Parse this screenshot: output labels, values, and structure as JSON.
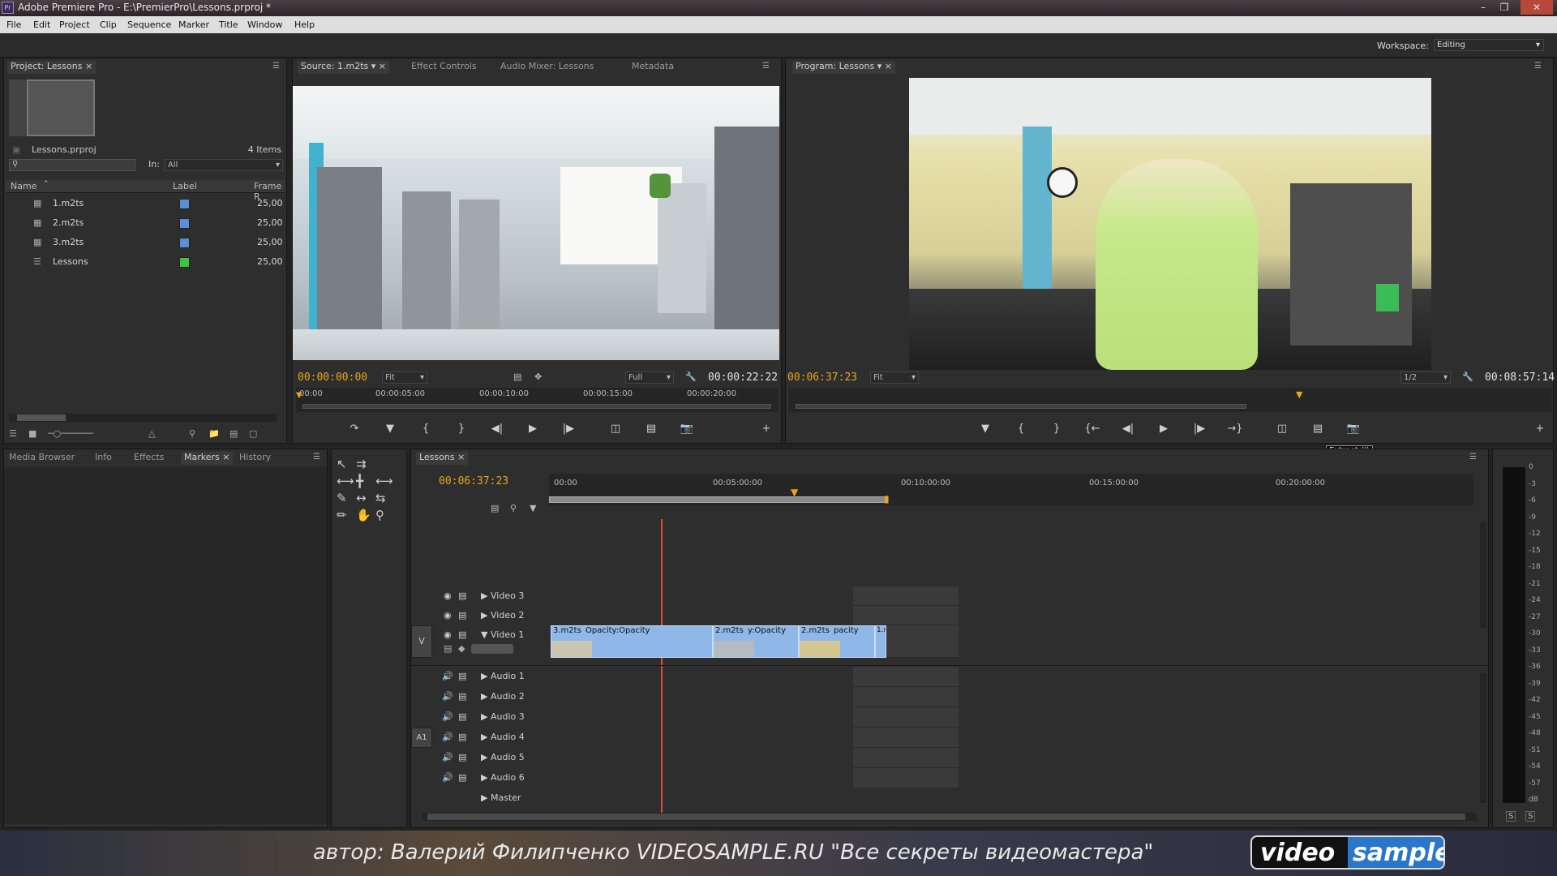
{
  "window": {
    "title": "Adobe Premiere Pro - E:\\PremierPro\\Lessons.prproj *",
    "app_icon": "Pr"
  },
  "menu": [
    "File",
    "Edit",
    "Project",
    "Clip",
    "Sequence",
    "Marker",
    "Title",
    "Window",
    "Help"
  ],
  "workspace": {
    "label": "Workspace:",
    "value": "Editing"
  },
  "project": {
    "tab": "Project: Lessons",
    "file": "Lessons.prproj",
    "count": "4 Items",
    "in_label": "In:",
    "in_value": "All",
    "columns": [
      "Name",
      "Label",
      "Frame R"
    ],
    "items": [
      {
        "name": "1.m2ts",
        "label_color": "#5a8fd8",
        "rate": "25,00"
      },
      {
        "name": "2.m2ts",
        "label_color": "#5a8fd8",
        "rate": "25,00"
      },
      {
        "name": "3.m2ts",
        "label_color": "#5a8fd8",
        "rate": "25,00"
      },
      {
        "name": "Lessons",
        "label_color": "#3cc63c",
        "rate": "25,00"
      }
    ]
  },
  "source": {
    "tabs": [
      "Source: 1.m2ts",
      "Effect Controls",
      "Audio Mixer: Lessons",
      "Metadata"
    ],
    "timecode": "00:00:00:00",
    "fit": "Fit",
    "quality": "Full",
    "duration": "00:00:22:22",
    "ruler": [
      "00:00",
      "00:00:05:00",
      "00:00:10:00",
      "00:00:15:00",
      "00:00:20:00"
    ]
  },
  "program": {
    "tab": "Program: Lessons",
    "timecode": "00:06:37:23",
    "fit": "Fit",
    "quality": "1/2",
    "duration": "00:08:57:14",
    "tooltip": "Extract (')"
  },
  "bottom_left": {
    "tabs": [
      "Media Browser",
      "Info",
      "Effects",
      "Markers",
      "History"
    ]
  },
  "timeline": {
    "tab": "Lessons",
    "timecode": "00:06:37:23",
    "ruler": [
      "00:00",
      "00:05:00:00",
      "00:10:00:00",
      "00:15:00:00",
      "00:20:00:00"
    ],
    "video_tracks": [
      "Video 3",
      "Video 2",
      "Video 1"
    ],
    "audio_tracks": [
      "Audio 1",
      "Audio 2",
      "Audio 3",
      "Audio 4",
      "Audio 5",
      "Audio 6"
    ],
    "master": "Master",
    "v_target": "V",
    "a_target": "A1",
    "clips": [
      {
        "name": "3.m2ts",
        "effect": "Opacity:Opacity"
      },
      {
        "name": "2.m2ts",
        "effect": "y:Opacity"
      },
      {
        "name": "2.m2ts",
        "effect": "pacity"
      },
      {
        "name": "1.m",
        "effect": ""
      }
    ]
  },
  "meter": {
    "scale": [
      "0",
      "-3",
      "-6",
      "-9",
      "-12",
      "-15",
      "-18",
      "-21",
      "-24",
      "-27",
      "-30",
      "-33",
      "-36",
      "-39",
      "-42",
      "-45",
      "-48",
      "-51",
      "-54",
      "-57",
      "dB"
    ],
    "buttons": [
      "S",
      "S"
    ]
  },
  "caption": {
    "text": "автор: Валерий Филипченко   VIDEOSAMPLE.RU   \"Все секреты видеомастера\"",
    "logo_a": "video",
    "logo_b": "sample"
  }
}
